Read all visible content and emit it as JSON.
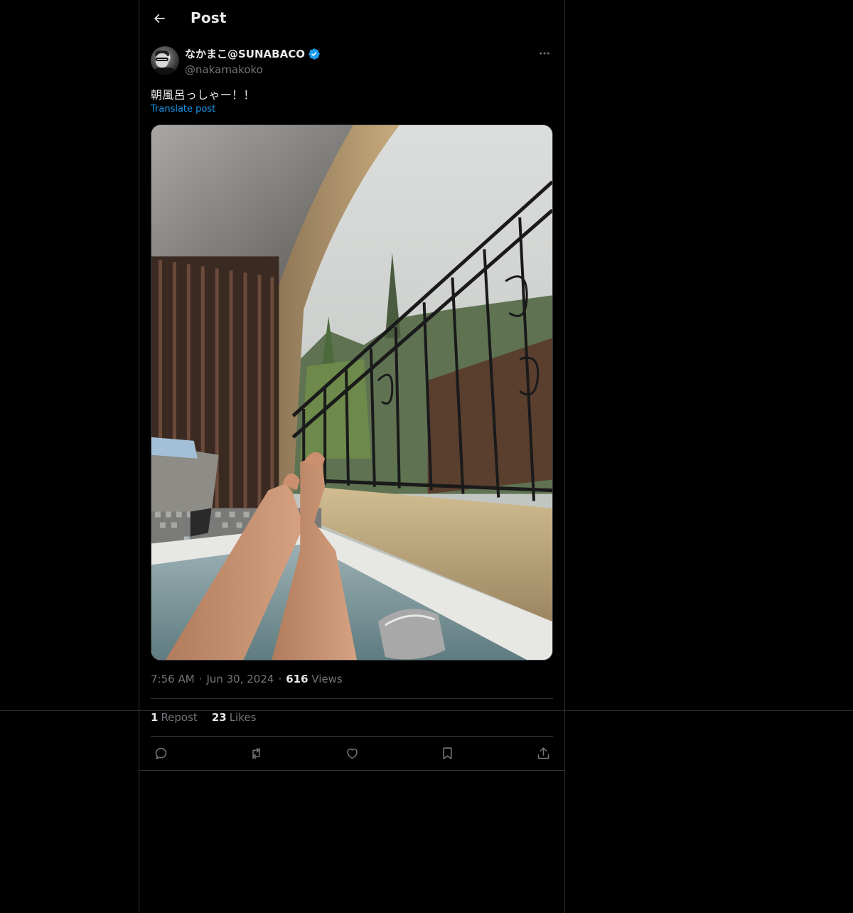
{
  "header": {
    "title": "Post",
    "back_icon": "arrow-left-icon"
  },
  "author": {
    "display_name": "なかまこ@SUNABACO",
    "handle": "@nakamakoko",
    "verified": true,
    "verified_color": "#1d9bf0"
  },
  "post": {
    "text": "朝風呂っしゃー！！",
    "translate_label": "Translate post",
    "image_description_icon": "photo"
  },
  "meta": {
    "time": "7:56 AM",
    "separator": "·",
    "date": "Jun 30, 2024",
    "views_count": "616",
    "views_label": "Views"
  },
  "stats": {
    "reposts_count": "1",
    "reposts_label": "Repost",
    "likes_count": "23",
    "likes_label": "Likes"
  },
  "actions": [
    {
      "name": "reply",
      "icon": "reply-icon"
    },
    {
      "name": "repost",
      "icon": "repost-icon"
    },
    {
      "name": "like",
      "icon": "heart-icon"
    },
    {
      "name": "bookmark",
      "icon": "bookmark-icon"
    },
    {
      "name": "share",
      "icon": "share-icon"
    }
  ],
  "colors": {
    "background": "#000000",
    "text_primary": "#e7e9ea",
    "text_secondary": "#71767b",
    "accent": "#1d9bf0",
    "border": "#2f3336"
  }
}
